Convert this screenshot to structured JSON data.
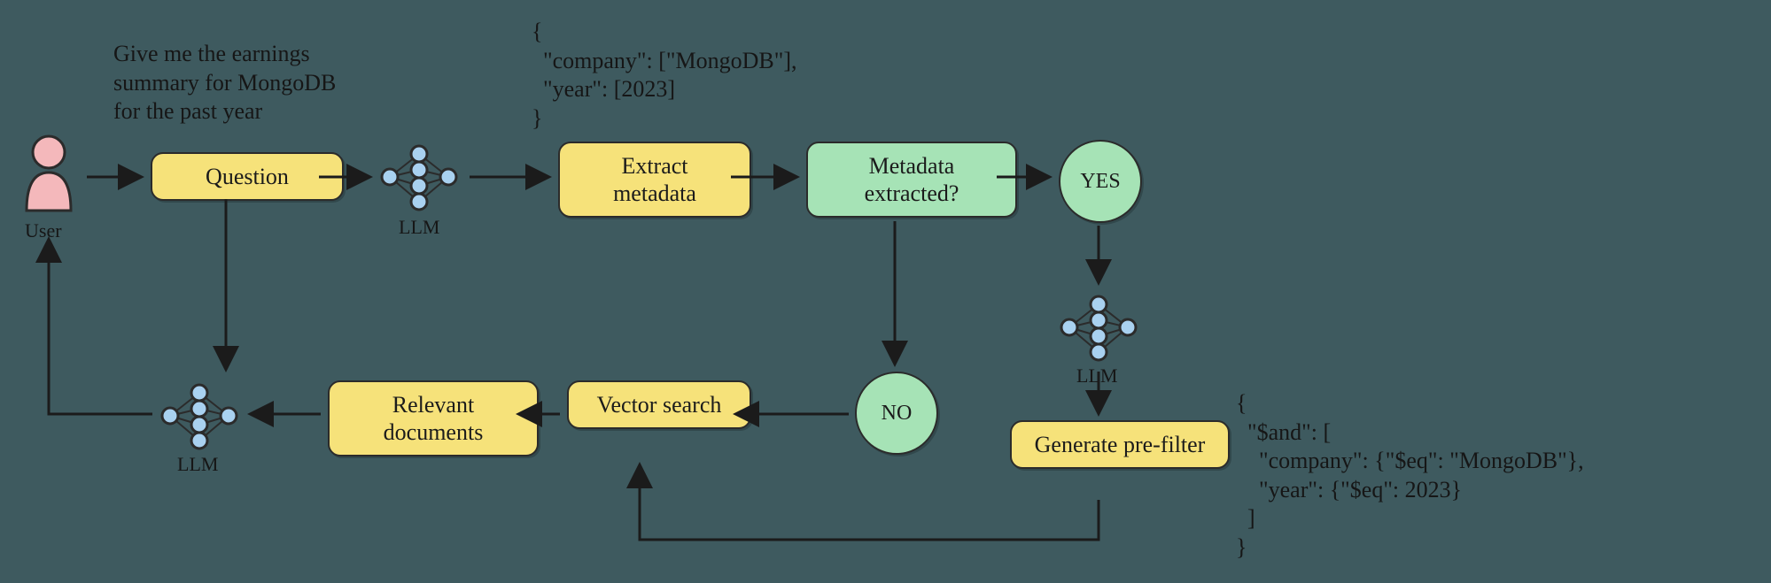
{
  "user_label": "User",
  "user_question": "Give me the earnings\nsummary for MongoDB\nfor the past year",
  "question_node": "Question",
  "llm_label_1": "LLM",
  "extract_metadata_node": "Extract\nmetadata",
  "metadata_snippet": "{\n  \"company\": [\"MongoDB\"],\n  \"year\": [2023]\n}",
  "metadata_decision_node": "Metadata\nextracted?",
  "yes_node": "YES",
  "no_node": "NO",
  "llm_label_2": "LLM",
  "generate_prefilter_node": "Generate\npre-filter",
  "prefilter_snippet": "{\n  \"$and\": [\n    \"company\": {\"$eq\": \"MongoDB\"},\n    \"year\": {\"$eq\": 2023}\n  ]\n}",
  "vector_search_node": "Vector\nsearch",
  "relevant_docs_node": "Relevant\ndocuments",
  "llm_label_3": "LLM"
}
